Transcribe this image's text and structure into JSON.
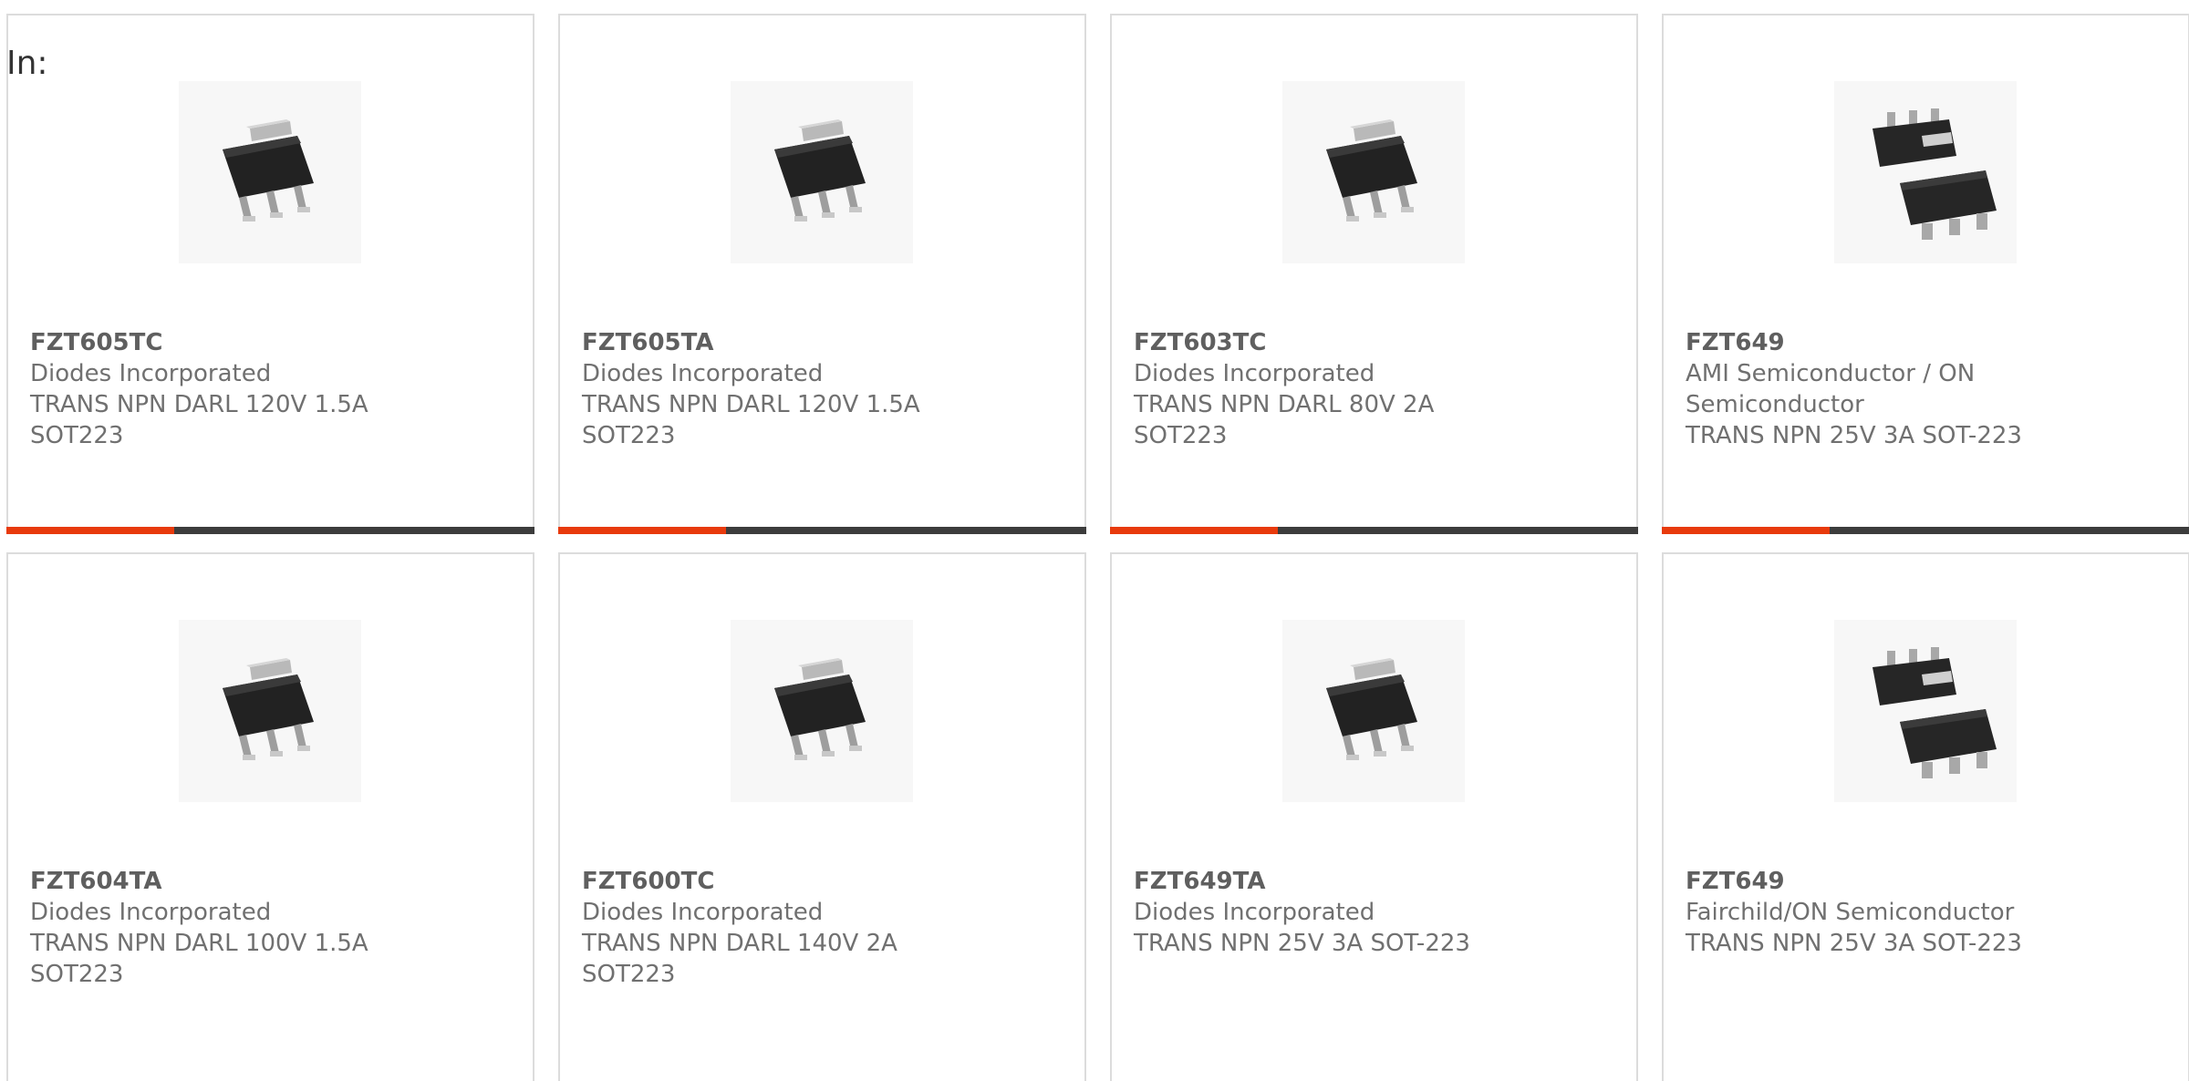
{
  "header": {
    "in_label": "In:"
  },
  "products": [
    {
      "part": "FZT605TC",
      "manufacturer": "Diodes Incorporated",
      "desc1": "TRANS NPN DARL 120V 1.5A",
      "desc2": "SOT223",
      "image": "sot223-single-icon"
    },
    {
      "part": "FZT605TA",
      "manufacturer": "Diodes Incorporated",
      "desc1": "TRANS NPN DARL 120V 1.5A",
      "desc2": "SOT223",
      "image": "sot223-single-icon"
    },
    {
      "part": "FZT603TC",
      "manufacturer": "Diodes Incorporated",
      "desc1": "TRANS NPN DARL 80V 2A",
      "desc2": "SOT223",
      "image": "sot223-single-icon"
    },
    {
      "part": "FZT649",
      "manufacturer": "AMI Semiconductor / ON Semiconductor",
      "desc1": "TRANS NPN 25V 3A SOT-223",
      "desc2": "",
      "image": "sot223-pair-icon"
    },
    {
      "part": "FZT604TA",
      "manufacturer": "Diodes Incorporated",
      "desc1": "TRANS NPN DARL 100V 1.5A",
      "desc2": "SOT223",
      "image": "sot223-single-icon"
    },
    {
      "part": "FZT600TC",
      "manufacturer": "Diodes Incorporated",
      "desc1": "TRANS NPN DARL 140V 2A",
      "desc2": "SOT223",
      "image": "sot223-single-icon"
    },
    {
      "part": "FZT649TA",
      "manufacturer": "Diodes Incorporated",
      "desc1": "TRANS NPN 25V 3A SOT-223",
      "desc2": "",
      "image": "sot223-single-icon"
    },
    {
      "part": "FZT649",
      "manufacturer": "Fairchild/ON Semiconductor",
      "desc1": "TRANS NPN 25V 3A SOT-223",
      "desc2": "",
      "image": "sot223-pair-icon"
    }
  ],
  "colors": {
    "accent": "#e83a0c",
    "bar": "#3c3c3c",
    "border": "#dcdcdc",
    "text": "#707070"
  }
}
